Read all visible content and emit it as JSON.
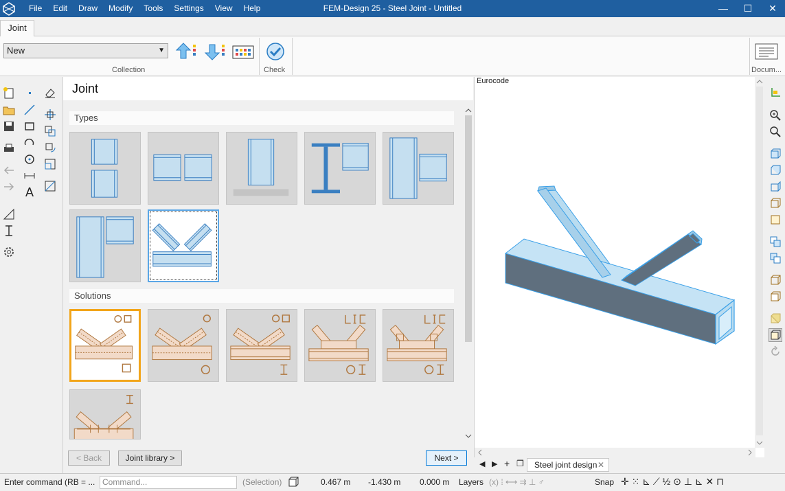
{
  "window": {
    "title": "FEM-Design 25 - Steel Joint - Untitled",
    "menu": [
      "File",
      "Edit",
      "Draw",
      "Modify",
      "Tools",
      "Settings",
      "View",
      "Help"
    ]
  },
  "ribbon": {
    "tab": "Joint",
    "collection_value": "New",
    "collection_label": "Collection",
    "check_label": "Check",
    "document_label": "Docum..."
  },
  "wizard": {
    "title": "Joint",
    "types_label": "Types",
    "solutions_label": "Solutions",
    "back_button": "< Back",
    "library_button": "Joint library >",
    "next_button": "Next >"
  },
  "viewport": {
    "code_label": "Eurocode",
    "doc_tab": "Steel joint design"
  },
  "statusbar": {
    "command_prompt": "Enter command (RB = ...",
    "command_placeholder": "Command...",
    "selection": "(Selection)",
    "x": "0.467 m",
    "y": "-1.430 m",
    "z": "0.000 m",
    "layers": "Layers",
    "snap": "Snap"
  },
  "colors": {
    "titlebar": "#1f5fa0",
    "tile_blue": "#c5dff0",
    "tile_outline": "#3a7fc1",
    "solution_tan": "#f2dac8",
    "solution_brown": "#b07840",
    "selected_orange": "#f2a51a"
  }
}
